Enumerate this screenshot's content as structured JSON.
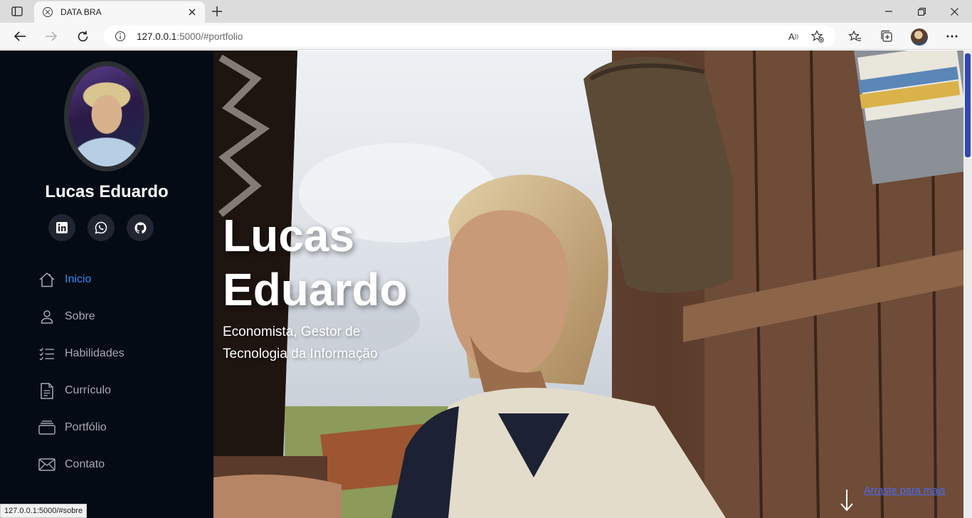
{
  "browser": {
    "tab_title": "DATA BRA",
    "url_host": "127.0.0.1",
    "url_path": ":5000/#portfolio",
    "status_url": "127.0.0.1:5000/#sobre",
    "url_icons": [
      "read-aloud-icon",
      "add-favorite-icon"
    ]
  },
  "sidebar": {
    "name": "Lucas Eduardo",
    "socials": [
      "linkedin-icon",
      "whatsapp-icon",
      "github-icon"
    ],
    "menu": [
      {
        "label": "Inicio",
        "icon": "home-icon",
        "active": true
      },
      {
        "label": "Sobre",
        "icon": "person-icon",
        "active": false
      },
      {
        "label": "Habilidades",
        "icon": "list-check-icon",
        "active": false
      },
      {
        "label": "Currículo",
        "icon": "document-icon",
        "active": false
      },
      {
        "label": "Portfólio",
        "icon": "collection-icon",
        "active": false
      },
      {
        "label": "Contato",
        "icon": "envelope-icon",
        "active": false
      }
    ]
  },
  "hero": {
    "title_line1": "Lucas",
    "title_line2": "Eduardo",
    "subtitle": "Economista, Gestor de Tecnologia da Informação",
    "scroll_link": "Arraste para mais"
  },
  "colors": {
    "sidebar_bg": "#040b14",
    "accent": "#2f8cf5",
    "menu_text": "#a8a9b4",
    "social_bg": "#212431"
  }
}
